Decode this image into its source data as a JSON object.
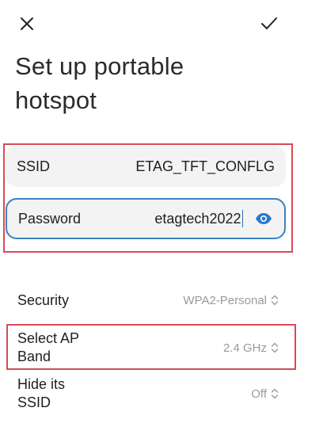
{
  "header": {
    "close_icon": "close-icon",
    "confirm_icon": "check-icon"
  },
  "title": "Set up portable hotspot",
  "fields": {
    "ssid": {
      "label": "SSID",
      "value": "ETAG_TFT_CONFLG"
    },
    "password": {
      "label": "Password",
      "value": "etagtech2022",
      "eye_icon": "eye-icon"
    }
  },
  "settings": {
    "security": {
      "label": "Security",
      "value": "WPA2-Personal"
    },
    "ap_band": {
      "label": "Select AP Band",
      "value": "2.4 GHz"
    },
    "hide_ssid": {
      "label": "Hide its SSID",
      "value": "Off"
    }
  },
  "colors": {
    "highlight_border": "#d84a55",
    "focus_border": "#3a82c4",
    "eye_icon": "#2b78c6",
    "secondary_text": "#9a9a9a"
  }
}
